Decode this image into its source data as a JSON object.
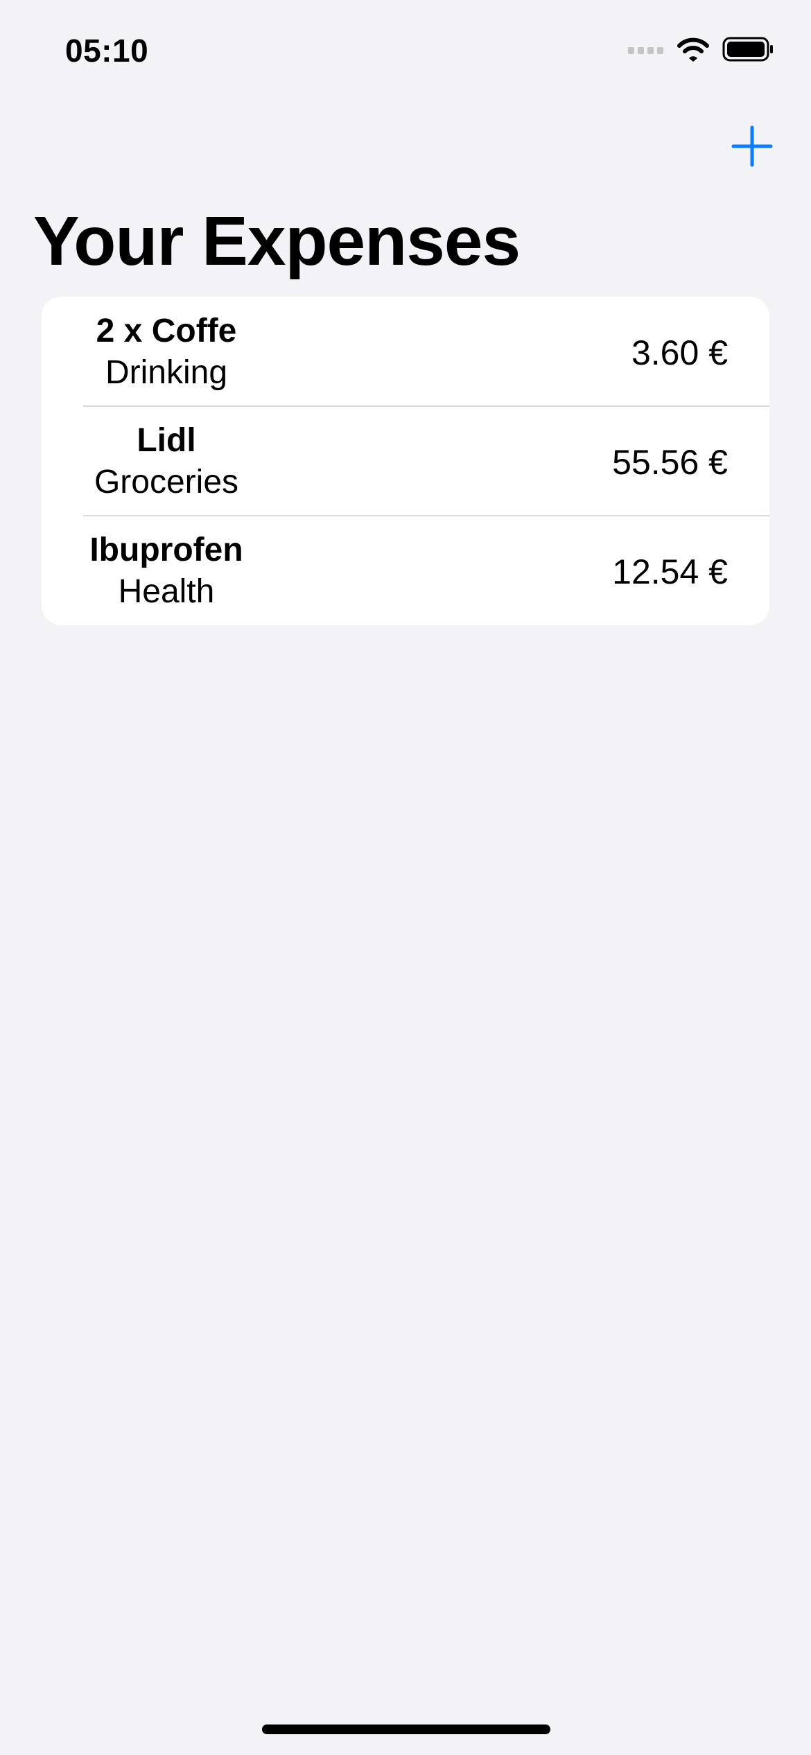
{
  "status_bar": {
    "time": "05:10"
  },
  "nav": {
    "add_icon": "plus-icon",
    "accent_color": "#0a7cff"
  },
  "title": "Your Expenses",
  "expenses": [
    {
      "name": "2 x Coffe",
      "type": "Drinking",
      "amount": "3.60 €"
    },
    {
      "name": "Lidl",
      "type": "Groceries",
      "amount": "55.56 €"
    },
    {
      "name": "Ibuprofen",
      "type": "Health",
      "amount": "12.54 €"
    }
  ]
}
